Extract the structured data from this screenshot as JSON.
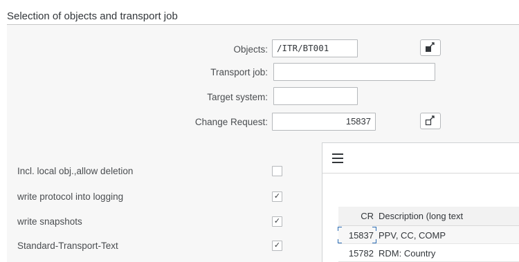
{
  "group": {
    "title": "Selection of objects and transport job"
  },
  "form": {
    "objects_label": "Objects:",
    "objects_value": "/ITR/BT001",
    "transport_job_label": "Transport job:",
    "transport_job_value": "",
    "target_system_label": "Target system:",
    "target_system_value": "",
    "change_request_label": "Change Request:",
    "change_request_value": "15837",
    "objects_button_icon": "multiple-selection-filled-icon",
    "change_request_button_icon": "multiple-selection-icon"
  },
  "options": [
    {
      "label": "Incl. local obj.,allow deletion",
      "checked": false,
      "mark": ""
    },
    {
      "label": "write protocol into logging",
      "checked": true,
      "mark": "✓"
    },
    {
      "label": "write snapshots",
      "checked": true,
      "mark": "✓"
    },
    {
      "label": "Standard-Transport-Text",
      "checked": true,
      "mark": "✓"
    }
  ],
  "popup": {
    "menu_icon": "hamburger-menu-icon",
    "columns": {
      "cr": "CR",
      "description": "Description (long text"
    },
    "rows": [
      {
        "cr": "15837",
        "description": "PPV, CC, COMP"
      },
      {
        "cr": "15782",
        "description": "RDM: Country"
      }
    ]
  }
}
